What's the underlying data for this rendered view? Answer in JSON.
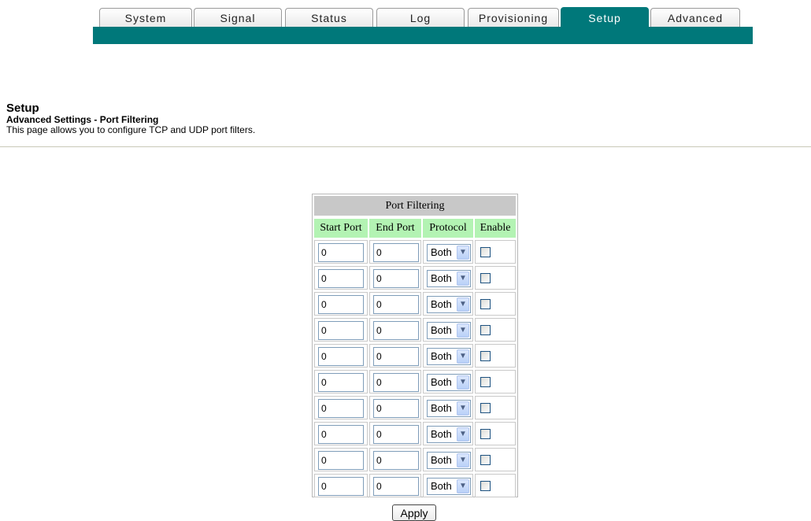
{
  "nav": {
    "tabs": [
      {
        "label": "System"
      },
      {
        "label": "Signal"
      },
      {
        "label": "Status"
      },
      {
        "label": "Log"
      },
      {
        "label": "Provisioning"
      },
      {
        "label": "Setup",
        "active": true
      },
      {
        "label": "Advanced"
      }
    ]
  },
  "header": {
    "title": "Setup",
    "subtitle": "Advanced Settings - Port Filtering",
    "description": "This page allows you to configure TCP and UDP port filters."
  },
  "port_filtering": {
    "title": "Port Filtering",
    "columns": [
      "Start Port",
      "End Port",
      "Protocol",
      "Enable"
    ],
    "rows": [
      {
        "start_port": "0",
        "end_port": "0",
        "protocol": "Both",
        "enabled": false
      },
      {
        "start_port": "0",
        "end_port": "0",
        "protocol": "Both",
        "enabled": false
      },
      {
        "start_port": "0",
        "end_port": "0",
        "protocol": "Both",
        "enabled": false
      },
      {
        "start_port": "0",
        "end_port": "0",
        "protocol": "Both",
        "enabled": false
      },
      {
        "start_port": "0",
        "end_port": "0",
        "protocol": "Both",
        "enabled": false
      },
      {
        "start_port": "0",
        "end_port": "0",
        "protocol": "Both",
        "enabled": false
      },
      {
        "start_port": "0",
        "end_port": "0",
        "protocol": "Both",
        "enabled": false
      },
      {
        "start_port": "0",
        "end_port": "0",
        "protocol": "Both",
        "enabled": false
      },
      {
        "start_port": "0",
        "end_port": "0",
        "protocol": "Both",
        "enabled": false
      },
      {
        "start_port": "0",
        "end_port": "0",
        "protocol": "Both",
        "enabled": false
      }
    ]
  },
  "actions": {
    "apply_label": "Apply"
  },
  "colors": {
    "accent": "#00787a",
    "header_green": "#b3f3b3",
    "title_gray": "#c8c8c8"
  }
}
